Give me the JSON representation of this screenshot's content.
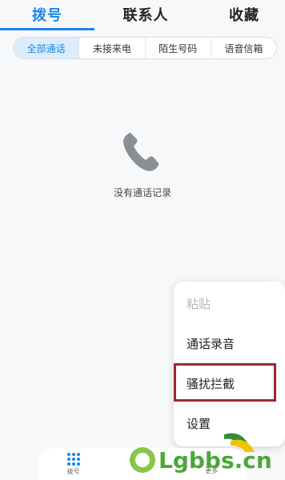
{
  "tabs": {
    "dial": "拨号",
    "contacts": "联系人",
    "favorites": "收藏"
  },
  "filters": [
    {
      "label": "全部通话"
    },
    {
      "label": "未接来电"
    },
    {
      "label": "陌生号码"
    },
    {
      "label": "语音信箱"
    }
  ],
  "empty_state": {
    "icon": "phone-icon",
    "text": "没有通话记录"
  },
  "menu": {
    "items": [
      {
        "label": "粘贴"
      },
      {
        "label": "通话录音"
      },
      {
        "label": "骚扰拦截"
      },
      {
        "label": "设置"
      }
    ]
  },
  "bottom_nav": {
    "dial_label": "拨号",
    "more_label": "更多"
  },
  "colors": {
    "accent": "#1a86e8",
    "highlight": "#9a2a2a"
  }
}
